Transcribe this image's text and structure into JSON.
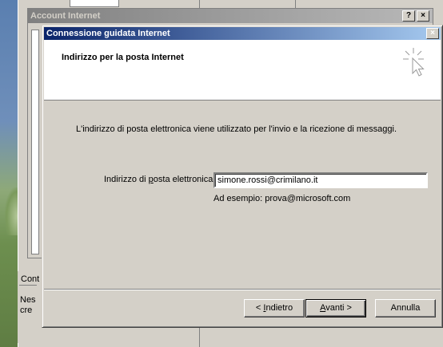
{
  "background_panel": {
    "tab_label": "Cont",
    "body_text": "Nes\ncre"
  },
  "account_window": {
    "title": "Account Internet",
    "help_button": "?",
    "close_button": "×"
  },
  "wizard": {
    "title": "Connessione guidata Internet",
    "close_button": "×",
    "header_title": "Indirizzo per la posta Internet",
    "description": "L'indirizzo di posta elettronica viene utilizzato per l'invio e la ricezione di messaggi.",
    "email_label_prefix": "Indirizzo di ",
    "email_label_accel": "p",
    "email_label_suffix": "osta elettronica:",
    "email_value": "simone.rossi@crimilano.it",
    "hint": "Ad esempio: prova@microsoft.com",
    "buttons": {
      "back": "< Indietro",
      "next": "Avanti >",
      "cancel": "Annulla"
    },
    "icon": "cursor-click-icon"
  },
  "colors": {
    "active_title_start": "#0a246a",
    "active_title_end": "#a6caf0",
    "inactive_title_start": "#808080",
    "face": "#d4d0c8"
  }
}
